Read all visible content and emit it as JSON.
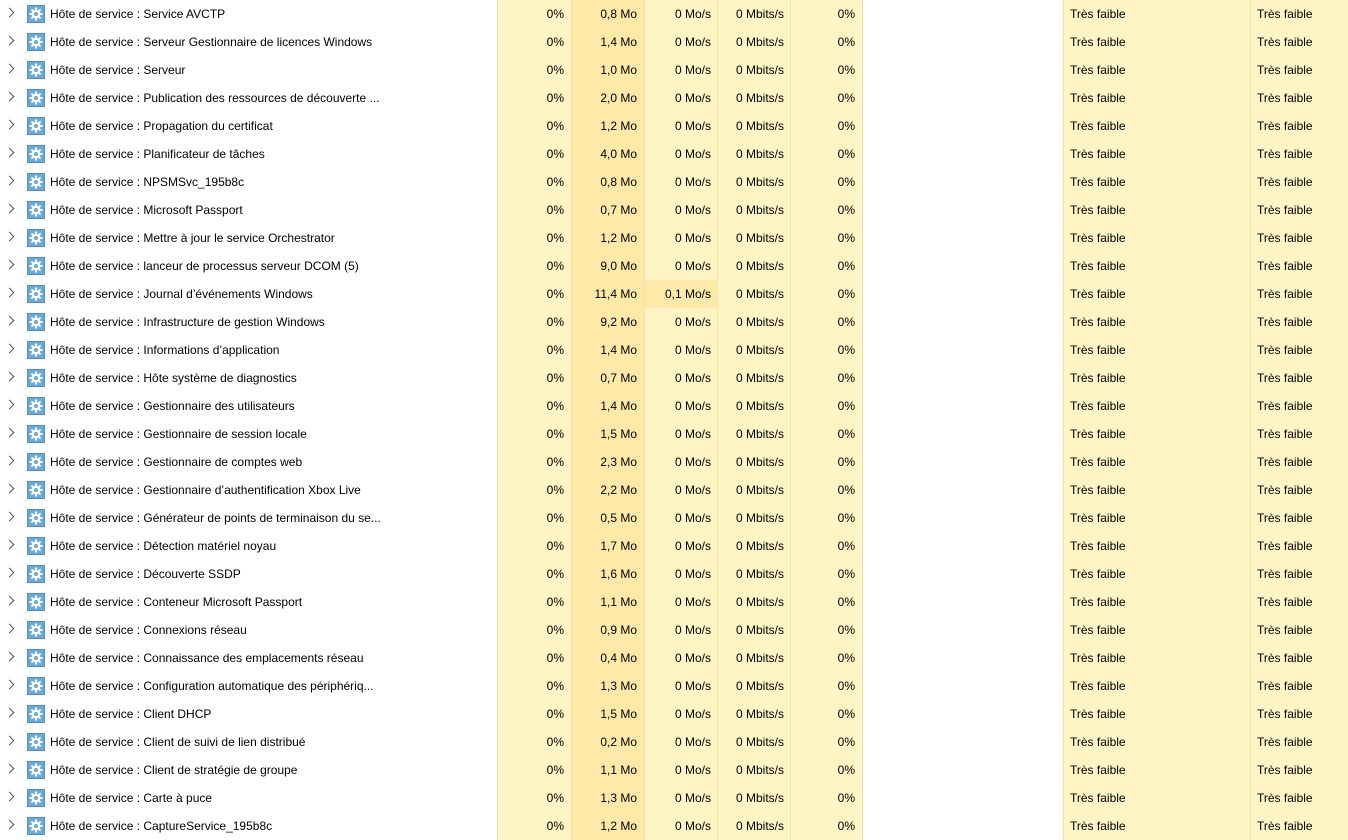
{
  "rows": [
    {
      "name": "Hôte de service : Service AVCTP",
      "cpu": "0%",
      "mem": "0,8 Mo",
      "disk": "0 Mo/s",
      "net": "0 Mbits/s",
      "gpu": "0%",
      "gpu_engine": "",
      "power": "Très faible",
      "power_trend": "Très faible"
    },
    {
      "name": "Hôte de service : Serveur Gestionnaire de licences Windows",
      "cpu": "0%",
      "mem": "1,4 Mo",
      "disk": "0 Mo/s",
      "net": "0 Mbits/s",
      "gpu": "0%",
      "gpu_engine": "",
      "power": "Très faible",
      "power_trend": "Très faible"
    },
    {
      "name": "Hôte de service : Serveur",
      "cpu": "0%",
      "mem": "1,0 Mo",
      "disk": "0 Mo/s",
      "net": "0 Mbits/s",
      "gpu": "0%",
      "gpu_engine": "",
      "power": "Très faible",
      "power_trend": "Très faible"
    },
    {
      "name": "Hôte de service : Publication des ressources de découverte ...",
      "cpu": "0%",
      "mem": "2,0 Mo",
      "disk": "0 Mo/s",
      "net": "0 Mbits/s",
      "gpu": "0%",
      "gpu_engine": "",
      "power": "Très faible",
      "power_trend": "Très faible"
    },
    {
      "name": "Hôte de service : Propagation du certificat",
      "cpu": "0%",
      "mem": "1,2 Mo",
      "disk": "0 Mo/s",
      "net": "0 Mbits/s",
      "gpu": "0%",
      "gpu_engine": "",
      "power": "Très faible",
      "power_trend": "Très faible"
    },
    {
      "name": "Hôte de service : Planificateur de tâches",
      "cpu": "0%",
      "mem": "4,0 Mo",
      "disk": "0 Mo/s",
      "net": "0 Mbits/s",
      "gpu": "0%",
      "gpu_engine": "",
      "power": "Très faible",
      "power_trend": "Très faible"
    },
    {
      "name": "Hôte de service : NPSMSvc_195b8c",
      "cpu": "0%",
      "mem": "0,8 Mo",
      "disk": "0 Mo/s",
      "net": "0 Mbits/s",
      "gpu": "0%",
      "gpu_engine": "",
      "power": "Très faible",
      "power_trend": "Très faible"
    },
    {
      "name": "Hôte de service : Microsoft Passport",
      "cpu": "0%",
      "mem": "0,7 Mo",
      "disk": "0 Mo/s",
      "net": "0 Mbits/s",
      "gpu": "0%",
      "gpu_engine": "",
      "power": "Très faible",
      "power_trend": "Très faible"
    },
    {
      "name": "Hôte de service : Mettre à jour le service Orchestrator",
      "cpu": "0%",
      "mem": "1,2 Mo",
      "disk": "0 Mo/s",
      "net": "0 Mbits/s",
      "gpu": "0%",
      "gpu_engine": "",
      "power": "Très faible",
      "power_trend": "Très faible"
    },
    {
      "name": "Hôte de service : lanceur de processus serveur DCOM (5)",
      "cpu": "0%",
      "mem": "9,0 Mo",
      "disk": "0 Mo/s",
      "net": "0 Mbits/s",
      "gpu": "0%",
      "gpu_engine": "",
      "power": "Très faible",
      "power_trend": "Très faible"
    },
    {
      "name": "Hôte de service : Journal d’événements Windows",
      "cpu": "0%",
      "mem": "11,4 Mo",
      "disk": "0,1 Mo/s",
      "net": "0 Mbits/s",
      "gpu": "0%",
      "gpu_engine": "",
      "power": "Très faible",
      "power_trend": "Très faible"
    },
    {
      "name": "Hôte de service : Infrastructure de gestion Windows",
      "cpu": "0%",
      "mem": "9,2 Mo",
      "disk": "0 Mo/s",
      "net": "0 Mbits/s",
      "gpu": "0%",
      "gpu_engine": "",
      "power": "Très faible",
      "power_trend": "Très faible"
    },
    {
      "name": "Hôte de service : Informations d’application",
      "cpu": "0%",
      "mem": "1,4 Mo",
      "disk": "0 Mo/s",
      "net": "0 Mbits/s",
      "gpu": "0%",
      "gpu_engine": "",
      "power": "Très faible",
      "power_trend": "Très faible"
    },
    {
      "name": "Hôte de service : Hôte système de diagnostics",
      "cpu": "0%",
      "mem": "0,7 Mo",
      "disk": "0 Mo/s",
      "net": "0 Mbits/s",
      "gpu": "0%",
      "gpu_engine": "",
      "power": "Très faible",
      "power_trend": "Très faible"
    },
    {
      "name": "Hôte de service : Gestionnaire des utilisateurs",
      "cpu": "0%",
      "mem": "1,4 Mo",
      "disk": "0 Mo/s",
      "net": "0 Mbits/s",
      "gpu": "0%",
      "gpu_engine": "",
      "power": "Très faible",
      "power_trend": "Très faible"
    },
    {
      "name": "Hôte de service : Gestionnaire de session locale",
      "cpu": "0%",
      "mem": "1,5 Mo",
      "disk": "0 Mo/s",
      "net": "0 Mbits/s",
      "gpu": "0%",
      "gpu_engine": "",
      "power": "Très faible",
      "power_trend": "Très faible"
    },
    {
      "name": "Hôte de service : Gestionnaire de comptes web",
      "cpu": "0%",
      "mem": "2,3 Mo",
      "disk": "0 Mo/s",
      "net": "0 Mbits/s",
      "gpu": "0%",
      "gpu_engine": "",
      "power": "Très faible",
      "power_trend": "Très faible"
    },
    {
      "name": "Hôte de service : Gestionnaire d’authentification Xbox Live",
      "cpu": "0%",
      "mem": "2,2 Mo",
      "disk": "0 Mo/s",
      "net": "0 Mbits/s",
      "gpu": "0%",
      "gpu_engine": "",
      "power": "Très faible",
      "power_trend": "Très faible"
    },
    {
      "name": "Hôte de service : Générateur de points de terminaison du se...",
      "cpu": "0%",
      "mem": "0,5 Mo",
      "disk": "0 Mo/s",
      "net": "0 Mbits/s",
      "gpu": "0%",
      "gpu_engine": "",
      "power": "Très faible",
      "power_trend": "Très faible"
    },
    {
      "name": "Hôte de service : Détection matériel noyau",
      "cpu": "0%",
      "mem": "1,7 Mo",
      "disk": "0 Mo/s",
      "net": "0 Mbits/s",
      "gpu": "0%",
      "gpu_engine": "",
      "power": "Très faible",
      "power_trend": "Très faible"
    },
    {
      "name": "Hôte de service : Découverte SSDP",
      "cpu": "0%",
      "mem": "1,6 Mo",
      "disk": "0 Mo/s",
      "net": "0 Mbits/s",
      "gpu": "0%",
      "gpu_engine": "",
      "power": "Très faible",
      "power_trend": "Très faible"
    },
    {
      "name": "Hôte de service : Conteneur Microsoft Passport",
      "cpu": "0%",
      "mem": "1,1 Mo",
      "disk": "0 Mo/s",
      "net": "0 Mbits/s",
      "gpu": "0%",
      "gpu_engine": "",
      "power": "Très faible",
      "power_trend": "Très faible"
    },
    {
      "name": "Hôte de service : Connexions réseau",
      "cpu": "0%",
      "mem": "0,9 Mo",
      "disk": "0 Mo/s",
      "net": "0 Mbits/s",
      "gpu": "0%",
      "gpu_engine": "",
      "power": "Très faible",
      "power_trend": "Très faible"
    },
    {
      "name": "Hôte de service : Connaissance des emplacements réseau",
      "cpu": "0%",
      "mem": "0,4 Mo",
      "disk": "0 Mo/s",
      "net": "0 Mbits/s",
      "gpu": "0%",
      "gpu_engine": "",
      "power": "Très faible",
      "power_trend": "Très faible"
    },
    {
      "name": "Hôte de service : Configuration automatique des périphériq...",
      "cpu": "0%",
      "mem": "1,3 Mo",
      "disk": "0 Mo/s",
      "net": "0 Mbits/s",
      "gpu": "0%",
      "gpu_engine": "",
      "power": "Très faible",
      "power_trend": "Très faible"
    },
    {
      "name": "Hôte de service : Client DHCP",
      "cpu": "0%",
      "mem": "1,5 Mo",
      "disk": "0 Mo/s",
      "net": "0 Mbits/s",
      "gpu": "0%",
      "gpu_engine": "",
      "power": "Très faible",
      "power_trend": "Très faible"
    },
    {
      "name": "Hôte de service : Client de suivi de lien distribué",
      "cpu": "0%",
      "mem": "0,2 Mo",
      "disk": "0 Mo/s",
      "net": "0 Mbits/s",
      "gpu": "0%",
      "gpu_engine": "",
      "power": "Très faible",
      "power_trend": "Très faible"
    },
    {
      "name": "Hôte de service : Client de stratégie de groupe",
      "cpu": "0%",
      "mem": "1,1 Mo",
      "disk": "0 Mo/s",
      "net": "0 Mbits/s",
      "gpu": "0%",
      "gpu_engine": "",
      "power": "Très faible",
      "power_trend": "Très faible"
    },
    {
      "name": "Hôte de service : Carte à puce",
      "cpu": "0%",
      "mem": "1,3 Mo",
      "disk": "0 Mo/s",
      "net": "0 Mbits/s",
      "gpu": "0%",
      "gpu_engine": "",
      "power": "Très faible",
      "power_trend": "Très faible"
    },
    {
      "name": "Hôte de service : CaptureService_195b8c",
      "cpu": "0%",
      "mem": "1,2 Mo",
      "disk": "0 Mo/s",
      "net": "0 Mbits/s",
      "gpu": "0%",
      "gpu_engine": "",
      "power": "Très faible",
      "power_trend": "Très faible"
    }
  ],
  "icon": {
    "name": "gear-icon",
    "color": "#6aa8d8"
  },
  "colors": {
    "heat_light": "#fff4c4",
    "heat_medium": "#ffe9a8"
  }
}
